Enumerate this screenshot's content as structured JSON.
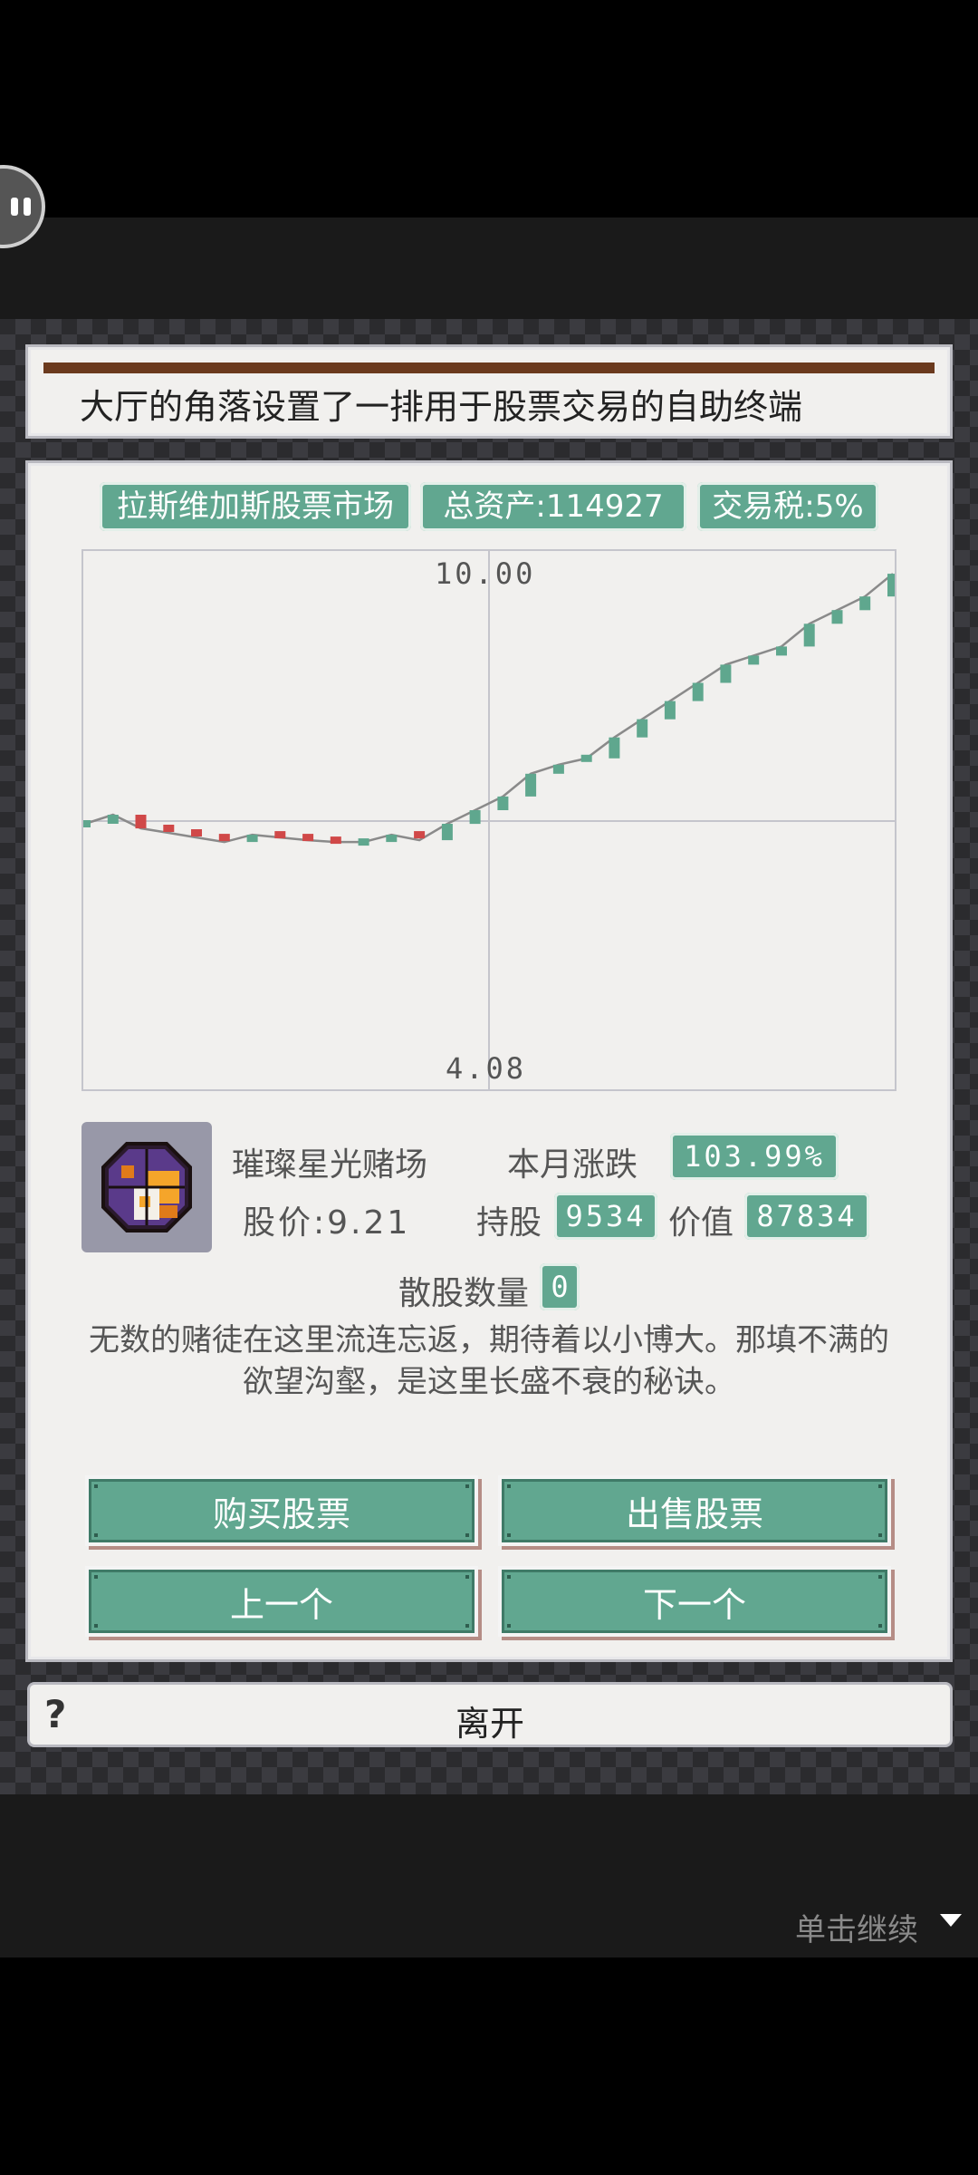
{
  "intro": {
    "text": "大厅的角落设置了一排用于股票交易的自助终端"
  },
  "header": {
    "market_name": "拉斯维加斯股票市场",
    "total_assets": "总资产:114927",
    "tax": "交易税:5%"
  },
  "chart_data": {
    "type": "line",
    "title": "",
    "ylim": [
      4.08,
      10.0
    ],
    "y_top_label": "10.00",
    "y_bottom_label": "4.08",
    "x": [
      1,
      2,
      3,
      4,
      5,
      6,
      7,
      8,
      9,
      10,
      11,
      12,
      13,
      14,
      15,
      16,
      17,
      18,
      19,
      20,
      21,
      22,
      23,
      24,
      25,
      26,
      27,
      28,
      29,
      30
    ],
    "values": [
      7.0,
      7.1,
      6.95,
      6.9,
      6.85,
      6.8,
      6.88,
      6.85,
      6.82,
      6.8,
      6.8,
      6.88,
      6.82,
      7.0,
      7.15,
      7.3,
      7.55,
      7.65,
      7.72,
      7.95,
      8.15,
      8.35,
      8.55,
      8.75,
      8.85,
      8.95,
      9.2,
      9.35,
      9.5,
      9.75
    ],
    "up_color": "#5fa78e",
    "down_color": "#d04848",
    "grid": true
  },
  "stock": {
    "name": "璀璨星光赌场",
    "monthly_change_label": "本月涨跌",
    "monthly_change": "103.99%",
    "price": "股价:9.21",
    "holding_label": "持股",
    "holding": "9534",
    "value_label": "价值",
    "value": "87834",
    "loose_label": "散股数量",
    "loose_count": "0",
    "description": "无数的赌徒在这里流连忘返，期待着以小博大。那填不满的欲望沟壑，是这里长盛不衰的秘诀。",
    "icon": "casino-emblem-icon"
  },
  "buttons": {
    "buy": "购买股票",
    "sell": "出售股票",
    "prev": "上一个",
    "next": "下一个"
  },
  "leave": {
    "help": "?",
    "label": "离开"
  },
  "footer": {
    "continue": "单击继续"
  },
  "colors": {
    "accent": "#61a790",
    "panel": "#f1f0ee",
    "pattern": "#2b2b2e"
  }
}
